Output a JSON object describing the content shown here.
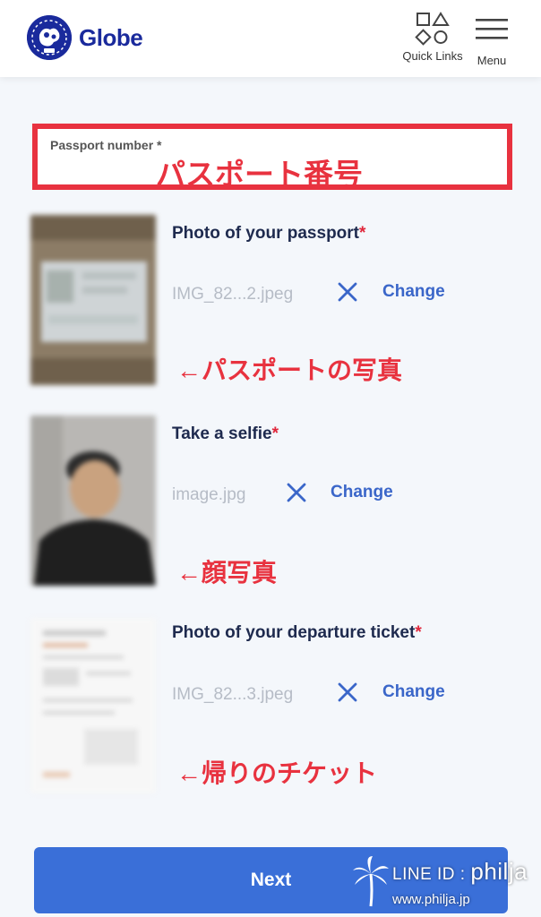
{
  "header": {
    "brand": "Globe",
    "quick_links_label": "Quick Links",
    "menu_label": "Menu"
  },
  "passport_field": {
    "label": "Passport number",
    "required_mark": "*",
    "annotation": "パスポート番号"
  },
  "uploads": [
    {
      "title": "Photo of your passport",
      "required_mark": "*",
      "filename": "IMG_82...2.jpeg",
      "change_label": "Change",
      "annotation": "←パスポートの写真"
    },
    {
      "title": "Take a selfie",
      "required_mark": "*",
      "filename": "image.jpg",
      "change_label": "Change",
      "annotation": "←顔写真"
    },
    {
      "title": "Photo of your departure ticket",
      "required_mark": "*",
      "filename": "IMG_82...3.jpeg",
      "change_label": "Change",
      "annotation": "←帰りのチケット"
    }
  ],
  "next_label": "Next",
  "watermark": {
    "line_prefix": "LINE ID : ",
    "line_id": "philja",
    "url": "www.philja.jp"
  },
  "colors": {
    "brand_navy": "#1a2a9c",
    "accent_blue": "#3a6fd8",
    "link_blue": "#3a66c9",
    "annotation_red": "#e8323f",
    "background": "#f4f7fb"
  }
}
